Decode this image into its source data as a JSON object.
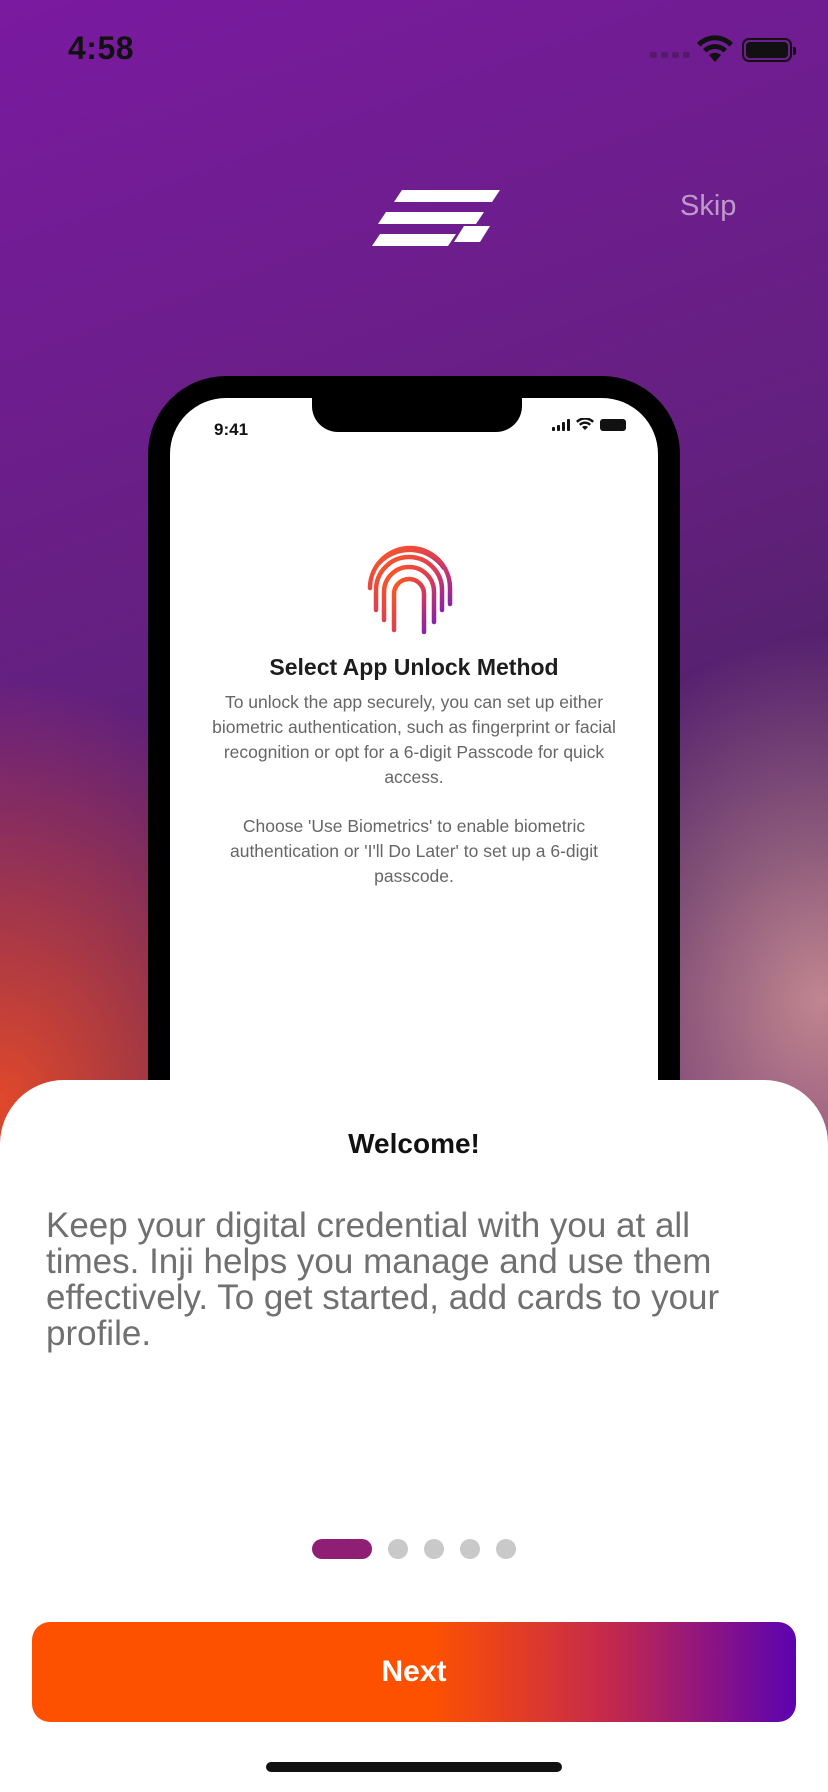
{
  "status_bar": {
    "time": "4:58"
  },
  "header": {
    "skip_label": "Skip"
  },
  "mockup": {
    "time": "9:41",
    "title": "Select App Unlock Method",
    "paragraph1": "To unlock the app securely, you can set up either biometric authentication, such as fingerprint or facial recognition or opt for a 6-digit Passcode for quick access.",
    "paragraph2": "Choose 'Use Biometrics' to enable biometric authentication or 'I'll Do Later' to set up a 6-digit passcode."
  },
  "sheet": {
    "title": "Welcome!",
    "description": "Keep your digital credential with you at all times. Inji helps you manage and use them effectively. To get started, add cards to your profile."
  },
  "pagination": {
    "total": 5,
    "current": 1
  },
  "footer": {
    "next_label": "Next"
  },
  "colors": {
    "primary_orange": "#fe5100",
    "primary_purple": "#5b03b1",
    "active_dot": "#8f1f74",
    "inactive_dot": "#c9c9c9"
  }
}
